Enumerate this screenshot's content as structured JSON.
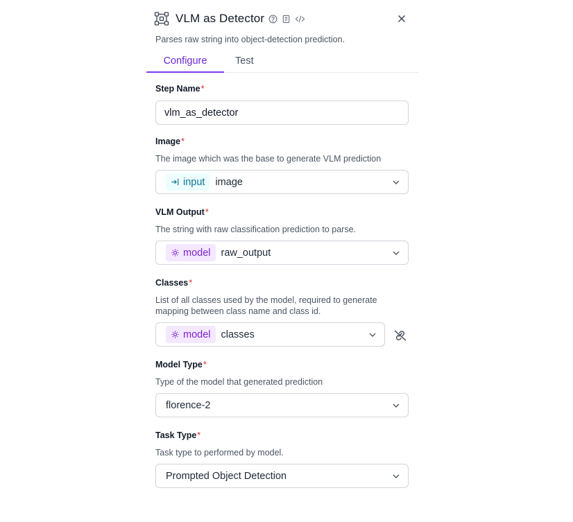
{
  "header": {
    "title": "VLM as Detector",
    "description": "Parses raw string into object-detection prediction."
  },
  "tabs": [
    {
      "label": "Configure",
      "active": true
    },
    {
      "label": "Test",
      "active": false
    }
  ],
  "fields": {
    "step_name": {
      "label": "Step Name",
      "required_mark": "*",
      "value": "vlm_as_detector"
    },
    "image": {
      "label": "Image",
      "required_mark": "*",
      "help": "The image which was the base to generate VLM prediction",
      "chip": "input",
      "value": "image"
    },
    "vlm_output": {
      "label": "VLM Output",
      "required_mark": "*",
      "help": "The string with raw classification prediction to parse.",
      "chip": "model",
      "value": "raw_output"
    },
    "classes": {
      "label": "Classes",
      "required_mark": "*",
      "help": "List of all classes used by the model, required to generate mapping between class name and class id.",
      "chip": "model",
      "value": "classes"
    },
    "model_type": {
      "label": "Model Type",
      "required_mark": "*",
      "help": "Type of the model that generated prediction",
      "value": "florence-2"
    },
    "task_type": {
      "label": "Task Type",
      "required_mark": "*",
      "help": "Task type to performed by model.",
      "value": "Prompted Object Detection"
    }
  },
  "icons": {
    "title": "workflow-nodes-icon",
    "header_actions": [
      "help-circle-icon",
      "docs-icon",
      "code-icon"
    ],
    "close": "close-icon",
    "input_chip": "arrow-right-to-bracket-icon",
    "model_chip": "model-gear-icon",
    "dropdown": "chevron-down-icon",
    "unlink": "unlink-icon"
  },
  "colors": {
    "accent": "#7c3aed",
    "required": "#dc2626",
    "input_chip_bg": "#ecfeff",
    "input_chip_fg": "#0e7490",
    "model_chip_bg": "#f3e8ff",
    "model_chip_fg": "#7e22ce"
  }
}
